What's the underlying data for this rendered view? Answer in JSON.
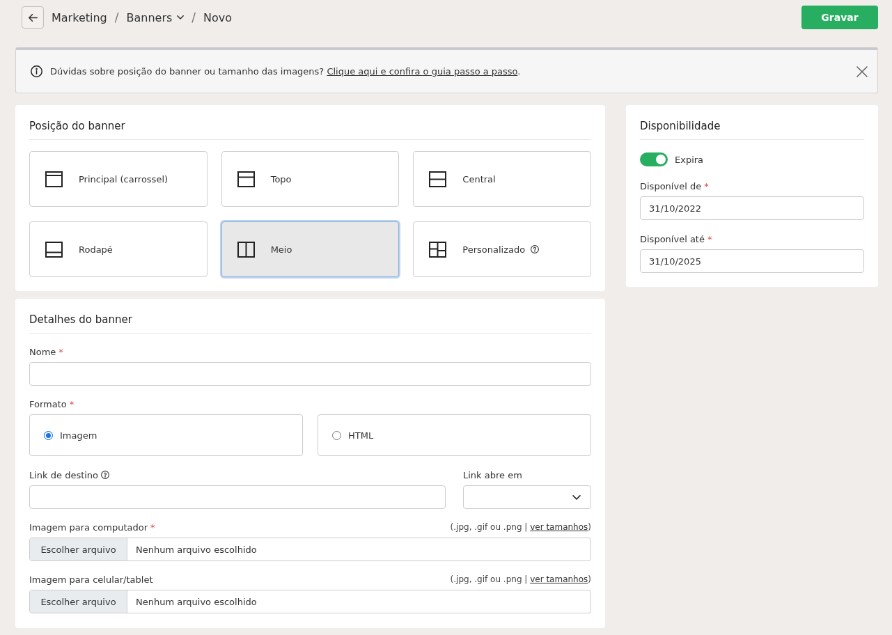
{
  "header": {
    "breadcrumb": [
      {
        "kind": "link",
        "label": "Marketing"
      },
      {
        "kind": "separator",
        "label": "/"
      },
      {
        "kind": "menu",
        "label": "Banners"
      },
      {
        "kind": "separator",
        "label": "/"
      },
      {
        "kind": "current",
        "label": "Novo"
      }
    ],
    "save_button": "Gravar"
  },
  "alert": {
    "text": "Dúvidas sobre posição do banner ou tamanho das imagens? ",
    "link": "Clique aqui e confira o guia passo a passo",
    "end": "."
  },
  "position": {
    "title": "Posição do banner",
    "options": [
      {
        "label": "Principal (carrossel)",
        "kind": "principal",
        "selected": false,
        "help": false
      },
      {
        "label": "Topo",
        "kind": "topo",
        "selected": false,
        "help": false
      },
      {
        "label": "Central",
        "kind": "central",
        "selected": false,
        "help": false
      },
      {
        "label": "Rodapé",
        "kind": "rodape",
        "selected": false,
        "help": false
      },
      {
        "label": "Meio",
        "kind": "meio",
        "selected": true,
        "help": false
      },
      {
        "label": "Personalizado",
        "kind": "personalizado",
        "selected": false,
        "help": true
      }
    ]
  },
  "details": {
    "title": "Detalhes do banner",
    "name_field": {
      "label": "Nome",
      "required_mark": "*"
    },
    "format": {
      "label": "Formato",
      "required_mark": "*",
      "options": [
        {
          "label": "Imagem",
          "selected": true
        },
        {
          "label": "HTML",
          "selected": false
        }
      ]
    },
    "link_field": {
      "label": "Link de destino",
      "help": true
    },
    "target_field": {
      "label": "Link abre em"
    },
    "uploads": [
      {
        "label": "Imagem para computador",
        "required_mark": "*",
        "hint": "(.jpg, .gif ou .png | ",
        "hint_link": "ver tamanhos",
        "hint_end": ")",
        "button": "Escolher arquivo",
        "status": "Nenhum arquivo escolhido"
      },
      {
        "label": "Imagem para celular/tablet",
        "hint": "(.jpg, .gif ou .png | ",
        "hint_link": "ver tamanhos",
        "hint_end": ")",
        "button": "Escolher arquivo",
        "status": "Nenhum arquivo escolhido"
      }
    ]
  },
  "availability": {
    "title": "Disponibilidade",
    "expires": {
      "label": "Expira",
      "on": true
    },
    "dates": [
      {
        "label": "Disponível de",
        "required_mark": "*",
        "value": "31/10/2022"
      },
      {
        "label": "Disponível até",
        "required_mark": "*",
        "value": "31/10/2025"
      }
    ]
  }
}
